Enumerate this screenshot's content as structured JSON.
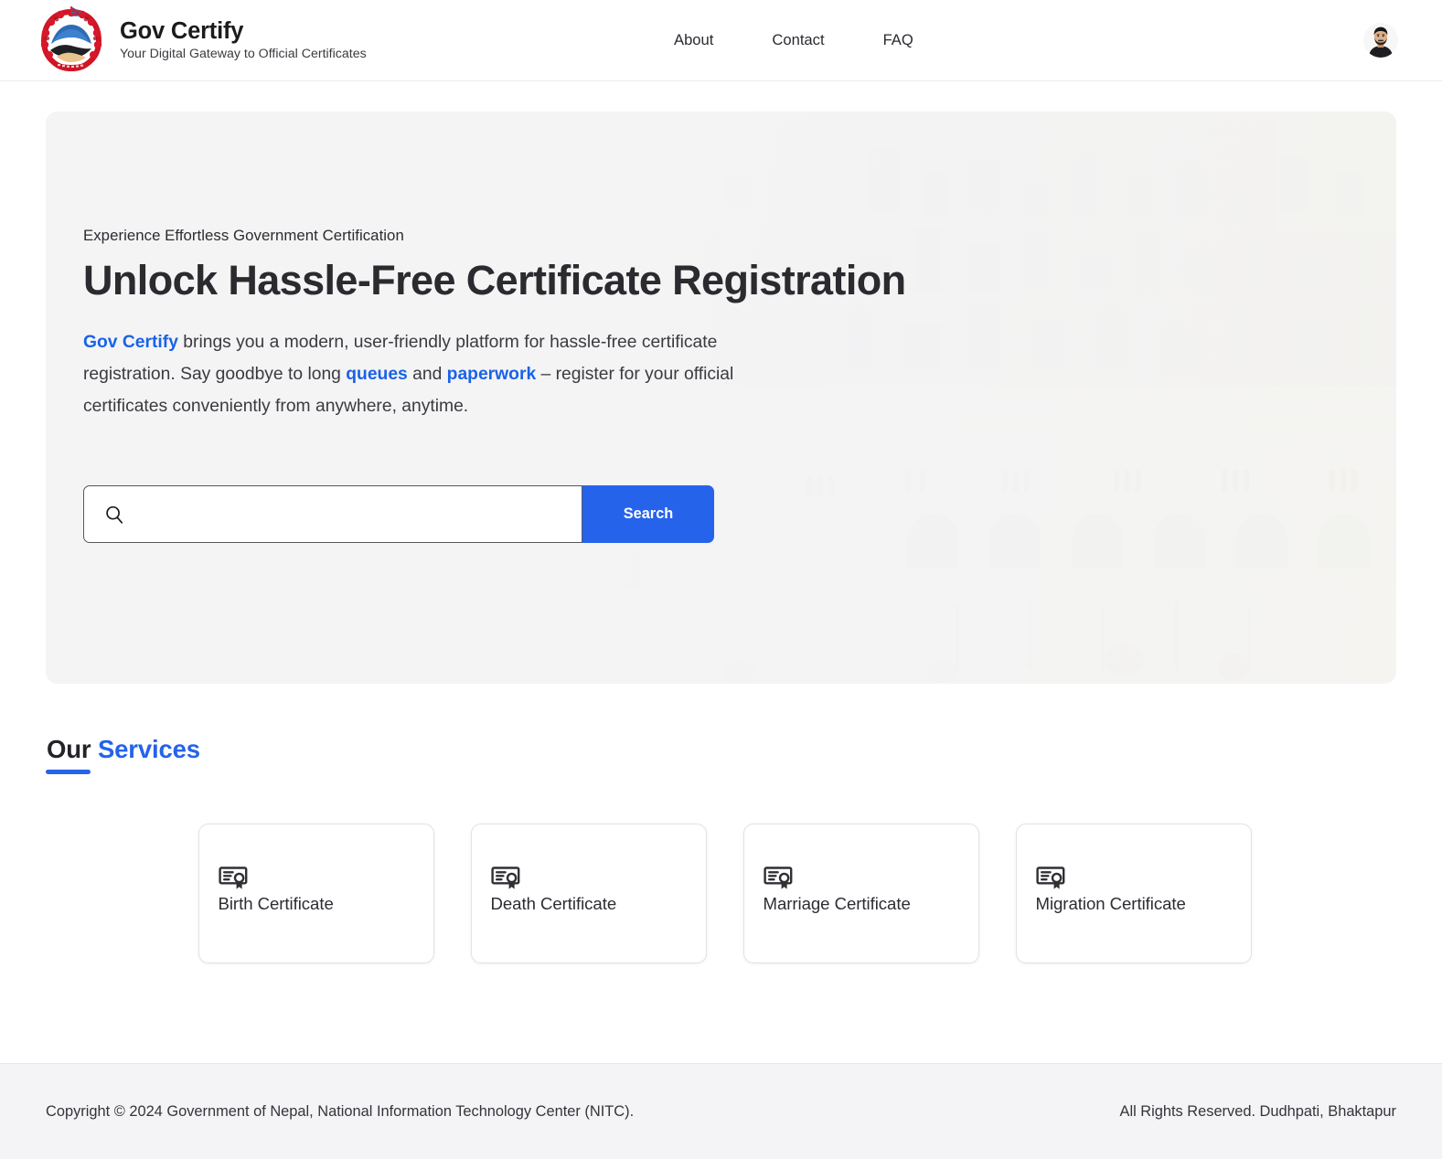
{
  "header": {
    "brand": {
      "emblem_icon": "nepal-government-emblem",
      "title": "Gov Certify",
      "tagline": "Your Digital Gateway to Official Certificates"
    },
    "nav": [
      {
        "label": "About"
      },
      {
        "label": "Contact"
      },
      {
        "label": "FAQ"
      }
    ],
    "avatar": {
      "icon": "user-avatar-photo"
    }
  },
  "hero": {
    "background_image": "singha-durbar-government-building",
    "eyebrow": "Experience Effortless Government Certification",
    "title": "Unlock Hassle-Free Certificate Registration",
    "description": {
      "part1": "Gov Certify",
      "part2": " brings you a modern, user-friendly platform for hassle-free certificate registration. Say goodbye to long ",
      "part3": "queues",
      "part4": " and ",
      "part5": "paperwork",
      "part6": " – register for your official certificates conveniently from anywhere, anytime."
    },
    "search": {
      "icon": "search-icon",
      "value": "",
      "placeholder": "",
      "button_label": "Search"
    }
  },
  "services": {
    "heading_dark": "Our",
    "heading_blue": "Services",
    "cards": [
      {
        "icon": "certificate-icon",
        "label": "Birth Certificate"
      },
      {
        "icon": "certificate-icon",
        "label": "Death Certificate"
      },
      {
        "icon": "certificate-icon",
        "label": "Marriage Certificate"
      },
      {
        "icon": "certificate-icon",
        "label": "Migration Certificate"
      }
    ]
  },
  "footer": {
    "left": "Copyright © 2024 Government of Nepal, National Information Technology Center (NITC).",
    "right": "All Rights Reserved. Dudhpati, Bhaktapur"
  },
  "colors": {
    "accent_blue": "#2563eb",
    "link_blue": "#1a62e8",
    "hero_bg": "#f4f4f5",
    "footer_bg": "#f4f4f6",
    "text_dark": "#232328"
  }
}
